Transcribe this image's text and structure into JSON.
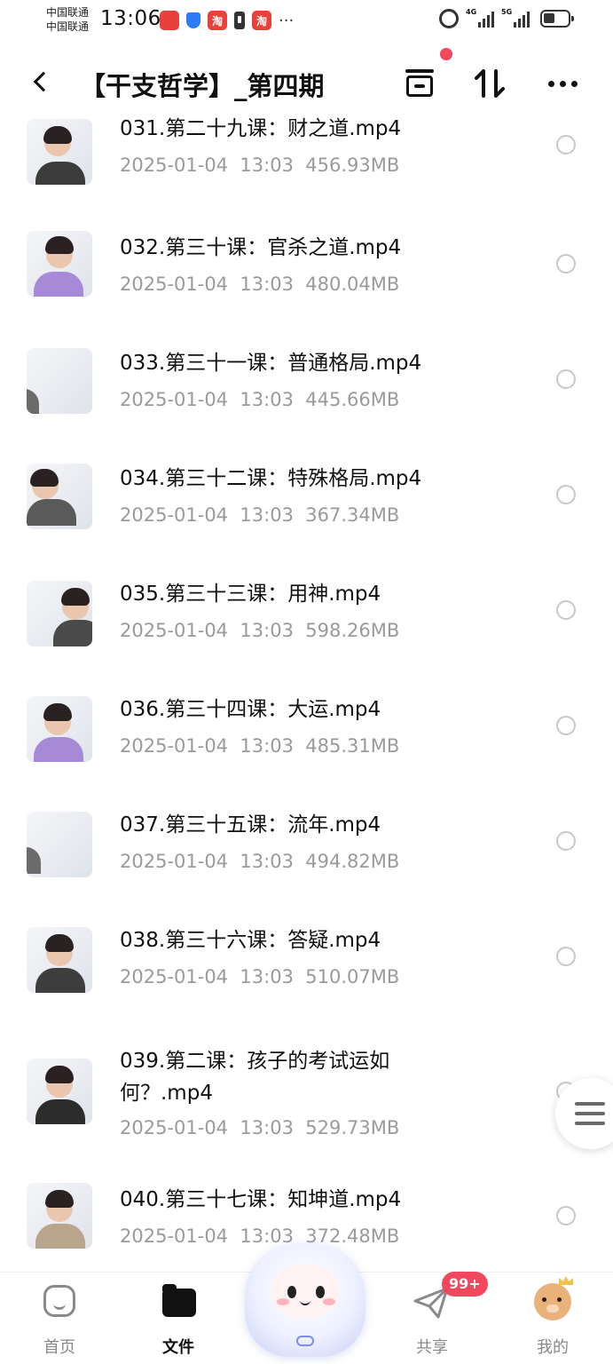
{
  "status_bar": {
    "carrier_1": "中国联通",
    "carrier_2": "中国联通",
    "time": "13:06",
    "app_badges": [
      {
        "icon": "huawei-app-icon",
        "color": "#e8413b",
        "text": ""
      },
      {
        "icon": "taobao-icon",
        "color": "#e8413b",
        "text": "淘"
      },
      {
        "icon": "taobao-icon",
        "color": "#e8413b",
        "text": "淘"
      }
    ],
    "more": "···",
    "network_1": "4G",
    "network_2": "5G"
  },
  "header": {
    "title": "【干支哲学】_第四期",
    "back_icon": "back-arrow-icon",
    "archive_icon": "archive-box-icon",
    "sort_icon": "sort-icon",
    "more_icon": "more-dots-icon"
  },
  "files": [
    {
      "name": "031.第二十九课：财之道.mp4",
      "date": "2025-01-04",
      "time": "13:03",
      "size": "456.93MB",
      "shirt": "#3b3b3b"
    },
    {
      "name": "032.第三十课：官杀之道.mp4",
      "date": "2025-01-04",
      "time": "13:03",
      "size": "480.04MB",
      "shirt": "#a68ad8"
    },
    {
      "name": "033.第三十一课：普通格局.mp4",
      "date": "2025-01-04",
      "time": "13:03",
      "size": "445.66MB",
      "shirt": "#6b6b6b"
    },
    {
      "name": "034.第三十二课：特殊格局.mp4",
      "date": "2025-01-04",
      "time": "13:03",
      "size": "367.34MB",
      "shirt": "#5a5a5a"
    },
    {
      "name": "035.第三十三课：用神.mp4",
      "date": "2025-01-04",
      "time": "13:03",
      "size": "598.26MB",
      "shirt": "#4a4a4a"
    },
    {
      "name": "036.第三十四课：大运.mp4",
      "date": "2025-01-04",
      "time": "13:03",
      "size": "485.31MB",
      "shirt": "#a68ad8"
    },
    {
      "name": "037.第三十五课：流年.mp4",
      "date": "2025-01-04",
      "time": "13:03",
      "size": "494.82MB",
      "shirt": "#6b6b6b"
    },
    {
      "name": "038.第三十六课：答疑.mp4",
      "date": "2025-01-04",
      "time": "13:03",
      "size": "510.07MB",
      "shirt": "#3e3e3e"
    },
    {
      "name_line1": "039.第二课：孩子的考试运如",
      "name_line2": "何？.mp4",
      "date": "2025-01-04",
      "time": "13:03",
      "size": "529.73MB",
      "shirt": "#2c2c2c"
    },
    {
      "name": "040.第三十七课：知坤道.mp4",
      "date": "2025-01-04",
      "time": "13:03",
      "size": "372.48MB",
      "shirt": "#b9a58c"
    }
  ],
  "bottom_nav": {
    "items": [
      {
        "label": "首页",
        "icon": "home-icon"
      },
      {
        "label": "文件",
        "icon": "folder-icon",
        "active": true
      },
      {
        "label": "共享",
        "icon": "paper-plane-icon"
      },
      {
        "label": "我的",
        "icon": "bear-avatar-icon"
      }
    ],
    "share_badge": "99+",
    "center_icon": "mascot-icon"
  },
  "colors": {
    "accent_red": "#f2475d",
    "meta_gray": "#9a9a9a"
  }
}
